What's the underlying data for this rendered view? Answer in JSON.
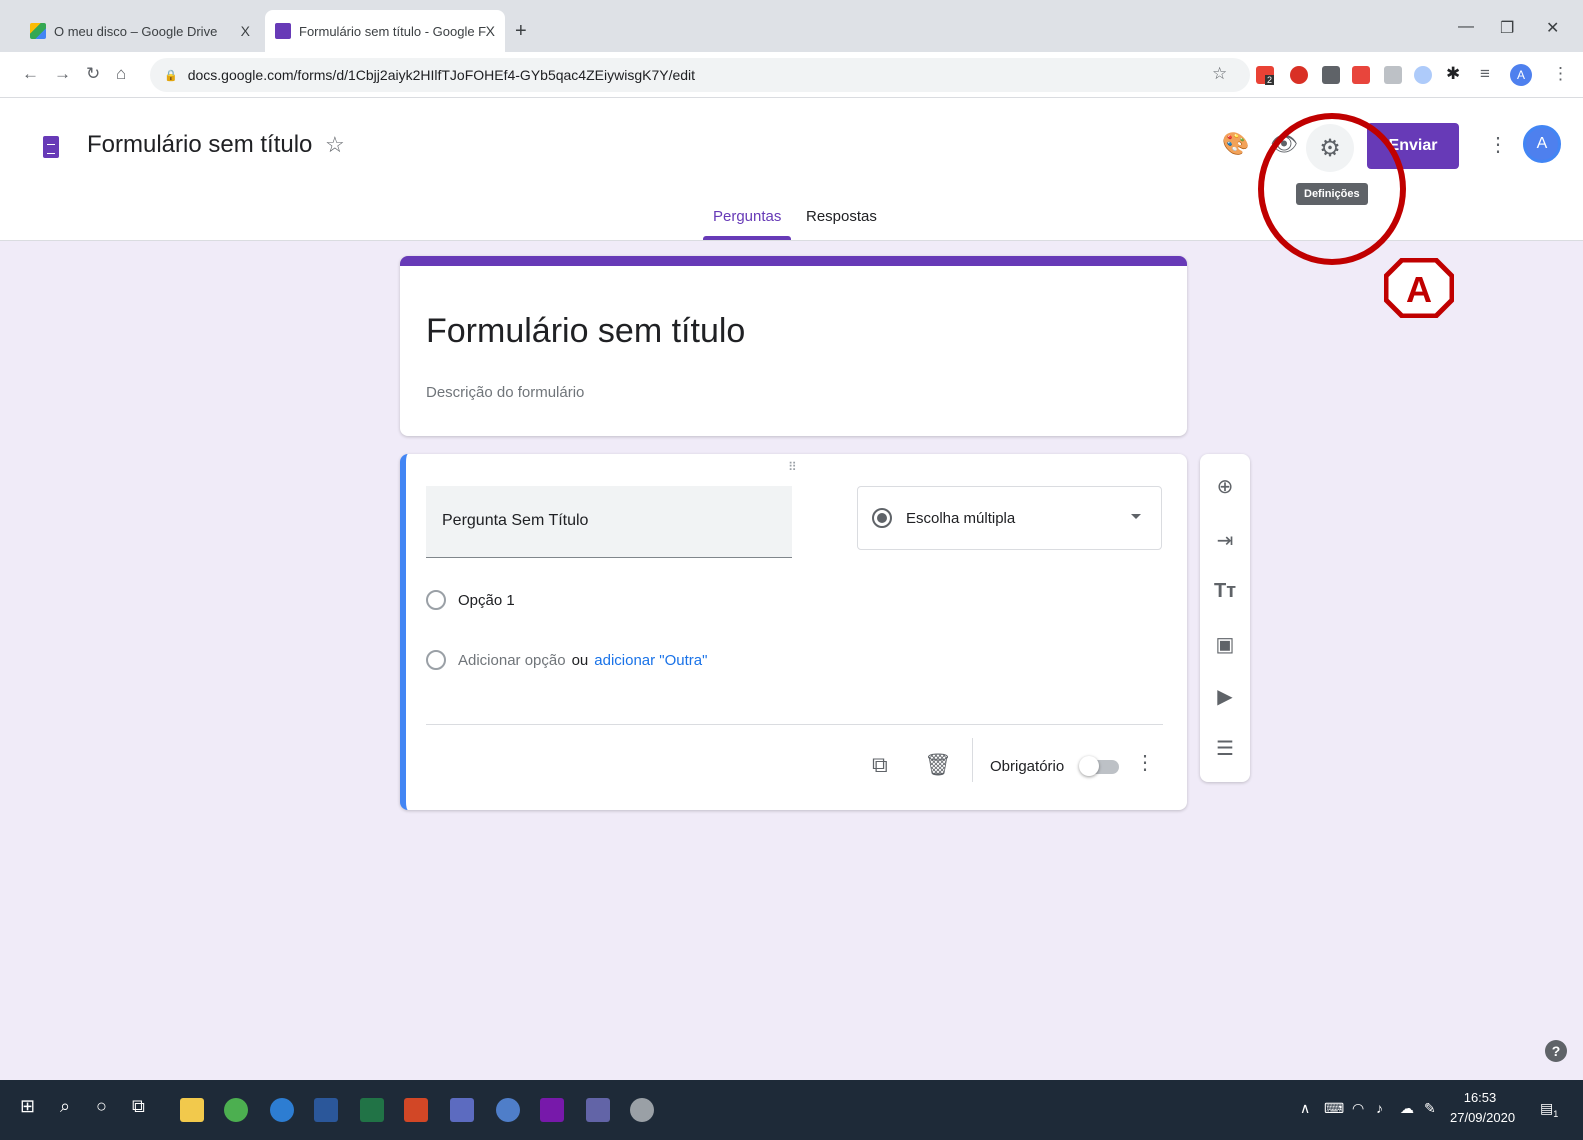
{
  "browser": {
    "tabs": [
      {
        "label": "O meu disco – Google Drive",
        "close": "X"
      },
      {
        "label": "Formulário sem título - Google F",
        "close": "X"
      }
    ],
    "new_tab": "+",
    "url": "docs.google.com/forms/d/1Cbjj2aiyk2HIlfTJoFOHEf4-GYb5qac4ZEiywisgK7Y/edit",
    "ext_badge": "2",
    "profile_initial": "A"
  },
  "forms_header": {
    "title": "Formulário sem título",
    "tooltip": "Definições",
    "send_label": "Enviar",
    "avatar_initial": "A",
    "tabs": [
      {
        "label": "Perguntas"
      },
      {
        "label": "Respostas"
      }
    ]
  },
  "annotation": {
    "label": "A",
    "color": "#c00000"
  },
  "title_card": {
    "title": "Formulário sem título",
    "description": "Descrição do formulário"
  },
  "question_card": {
    "question": "Pergunta Sem Título",
    "type": "Escolha múltipla",
    "option1": "Opção 1",
    "add_option": "Adicionar opção",
    "or": "ou",
    "add_other": "adicionar \"Outra\"",
    "required_label": "Obrigatório",
    "required": false
  },
  "side_tools": [
    "add-question-icon",
    "import-questions-icon",
    "add-title-icon",
    "add-image-icon",
    "add-video-icon",
    "add-section-icon"
  ],
  "taskbar": {
    "time": "16:53",
    "date": "27/09/2020",
    "notification_count": "1"
  },
  "colors": {
    "accent": "#673ab7",
    "background": "#f0ebf8",
    "question_accent": "#4285f4"
  }
}
